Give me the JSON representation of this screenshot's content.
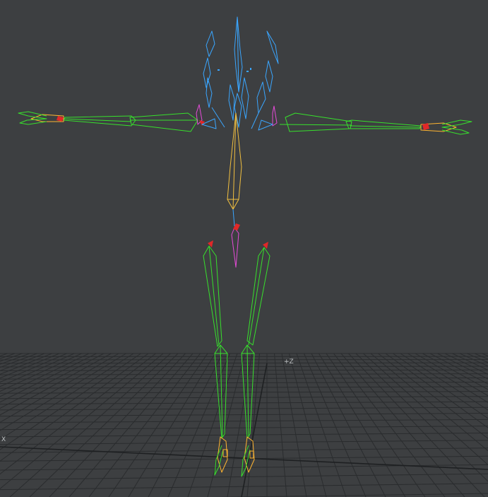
{
  "viewport": {
    "background": "#3d3f41",
    "grid_color": "#2a2c2e",
    "grid_axis_color": "#1e2022",
    "axis_labels": {
      "z": "+Z",
      "x": "X"
    }
  },
  "rig": {
    "colors": {
      "spine": "#f2c040",
      "arm": "#37e02c",
      "leg": "#37e02c",
      "head": "#3aa6ff",
      "root": "#e64bd8",
      "hand": "#ffb531",
      "tip": "#e02828"
    }
  }
}
